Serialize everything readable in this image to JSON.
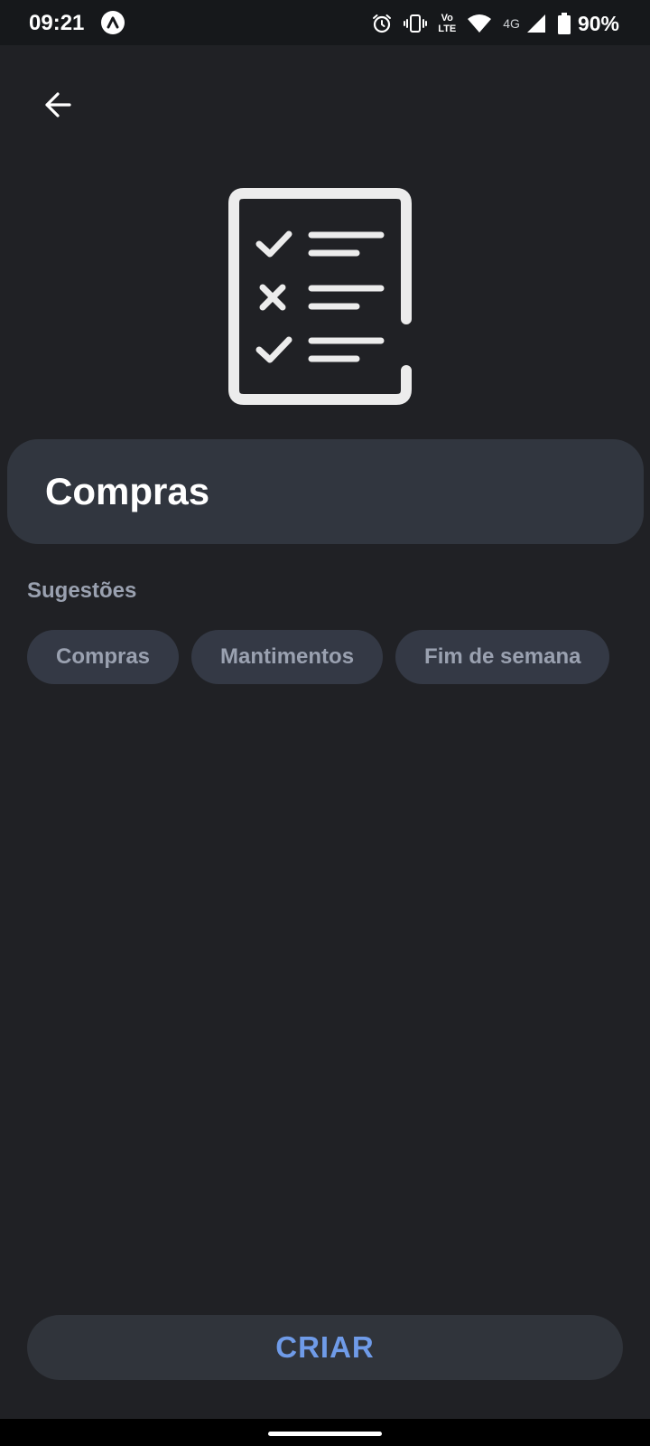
{
  "status_bar": {
    "time": "09:21",
    "app_icon": "chevron-up-icon",
    "icons": [
      "alarm-icon",
      "vibrate-icon",
      "volte-icon",
      "wifi-icon",
      "signal-icon",
      "battery-icon"
    ],
    "volte_top": "Vo",
    "volte_bottom": "LTE",
    "network": "4G",
    "battery": "90%"
  },
  "header": {
    "back_icon": "arrow-left-icon"
  },
  "hero": {
    "icon": "checklist-icon"
  },
  "name_field": {
    "value": "Compras"
  },
  "suggestions": {
    "title": "Sugestões",
    "chips": [
      {
        "label": "Compras"
      },
      {
        "label": "Mantimentos"
      },
      {
        "label": "Fim de semana"
      }
    ]
  },
  "create_button": {
    "label": "CRIAR"
  },
  "colors": {
    "background": "#202125",
    "surface": "#31363f",
    "chip": "#343945",
    "muted_text": "#9aa1b0",
    "accent": "#6f9be8"
  }
}
